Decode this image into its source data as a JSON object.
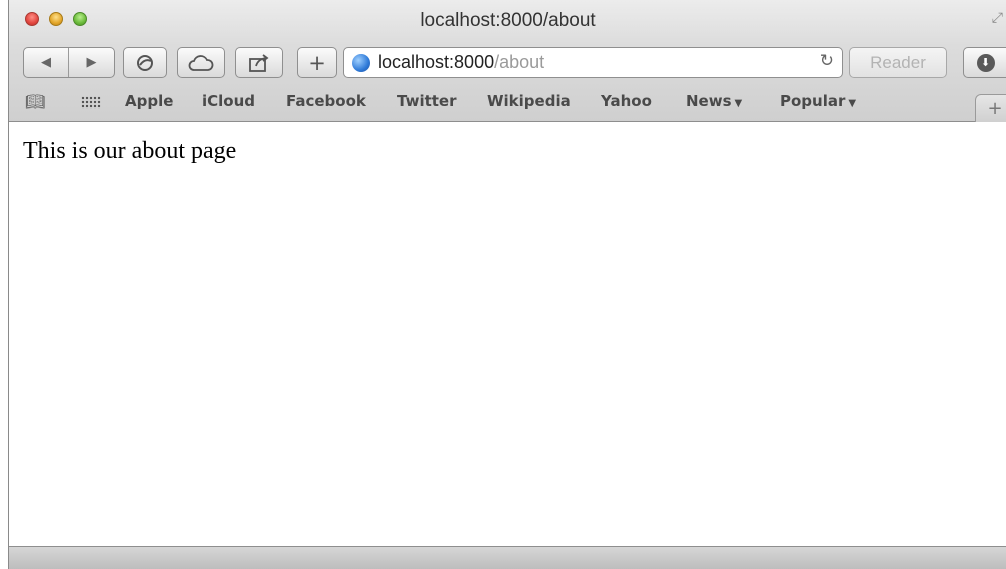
{
  "window": {
    "title": "localhost:8000/about"
  },
  "toolbar": {
    "back_icon": "back-arrow-icon",
    "forward_icon": "forward-arrow-icon",
    "new_tab_label": "+",
    "url_host": "localhost:8000",
    "url_path": "/about",
    "reload_icon": "↻",
    "reader_label": "Reader"
  },
  "bookmarks": {
    "items": [
      {
        "label": "Apple"
      },
      {
        "label": "iCloud"
      },
      {
        "label": "Facebook"
      },
      {
        "label": "Twitter"
      },
      {
        "label": "Wikipedia"
      },
      {
        "label": "Yahoo"
      },
      {
        "label": "News"
      },
      {
        "label": "Popular"
      }
    ],
    "add_tab_label": "+"
  },
  "page": {
    "text": "This is our about page"
  }
}
